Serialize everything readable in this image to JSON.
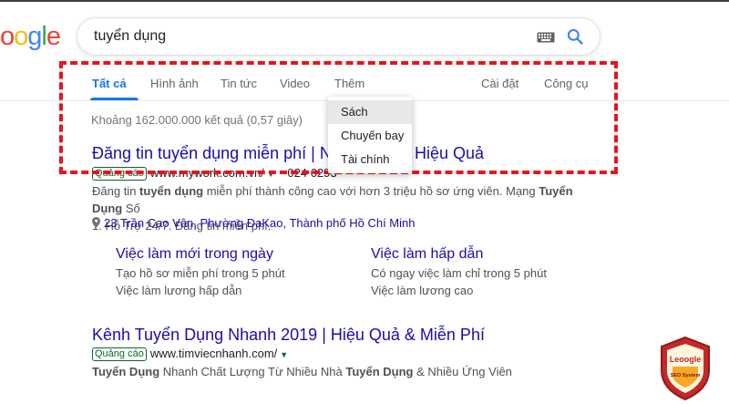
{
  "logo": {
    "letters": [
      {
        "ch": "o",
        "color": "#ea4335"
      },
      {
        "ch": "o",
        "color": "#fbbc05"
      },
      {
        "ch": "g",
        "color": "#4285f4"
      },
      {
        "ch": "l",
        "color": "#34a853"
      },
      {
        "ch": "e",
        "color": "#ea4335"
      }
    ]
  },
  "search": {
    "query": "tuyển dụng"
  },
  "tabs": {
    "all": "Tất cả",
    "images": "Hình ảnh",
    "news": "Tin tức",
    "video": "Video",
    "more": "Thêm",
    "settings": "Cài đặt",
    "tools": "Công cụ"
  },
  "result_stats": "Khoảng 162.000.000 kết quả (0,57 giây)",
  "more_menu": {
    "items": [
      "Sách",
      "Chuyến bay",
      "Tài chính"
    ]
  },
  "results": [
    {
      "title_a": "Đăng tin tuyển dụng miễn phí | Nha",
      "title_b": "Hiệu Quả",
      "ad_label": "Quảng cáo",
      "url": "www.mywork.com.vn/",
      "phone": "024 6293",
      "desc_line1_pre": "Đăng tin ",
      "desc_line1_bold": "tuyển dụng",
      "desc_line1_mid": " miễn phí thành công cao với hơn 3 triệu hồ sơ ứng viên. Mạng ",
      "desc_line1_bold2": "Tuyển Dụng",
      "desc_line1_post": " Số",
      "desc_line2": "1. Hỗ Trợ 24/7. Đăng tin miễn phí.",
      "address": "23 Trần Cao Vân, Phường ĐaKao, Thành phố Hồ Chí Minh",
      "sitelinks": [
        {
          "title": "Việc làm mới trong ngày",
          "line1": "Tạo hồ sơ miễn phí trong 5 phút",
          "line2": "Việc làm lương hấp dẫn"
        },
        {
          "title": "Việc làm hấp dẫn",
          "line1": "Có ngay việc làm chỉ trong 5 phút",
          "line2": "Việc làm lương cao"
        }
      ]
    },
    {
      "title": "Kênh Tuyển Dụng Nhanh 2019 | Hiệu Quả & Miễn Phí",
      "ad_label": "Quảng cáo",
      "url": "www.timviecnhanh.com/",
      "desc_b1": "Tuyển Dụng",
      "desc_m1": " Nhanh Chất Lượng Từ Nhiều Nhà ",
      "desc_b2": "Tuyển Dụng",
      "desc_m2": " & Nhiều Ứng Viên"
    }
  ],
  "badge": {
    "brand": "Leoogle",
    "caption": "SEO System"
  },
  "colors": {
    "accent": "#1a73e8",
    "link": "#1a0dab",
    "highlight": "#e8141c",
    "ad_green": "#0d652d"
  }
}
